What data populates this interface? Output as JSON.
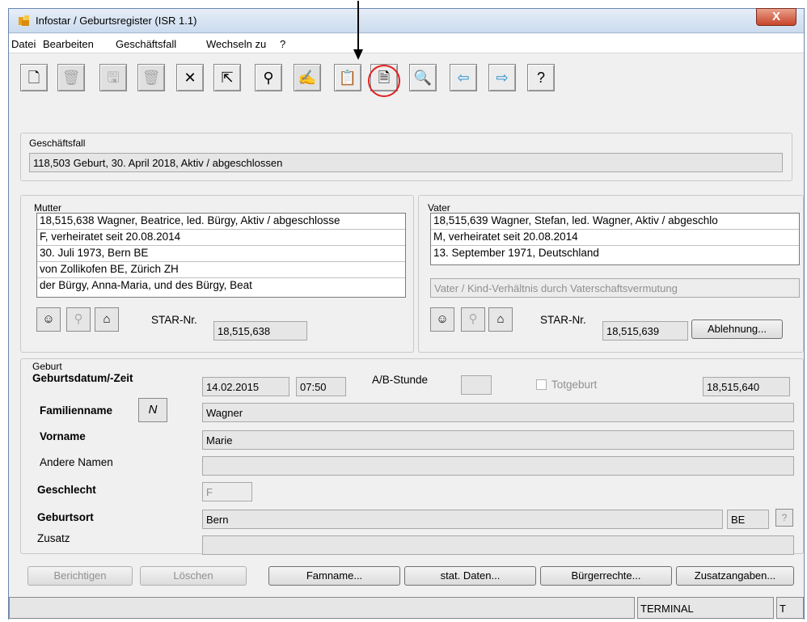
{
  "window": {
    "title": "Infostar / Geburtsregister (ISR 1.1)",
    "close": "X"
  },
  "menu": [
    "Datei",
    "Bearbeiten",
    "Geschäftsfall",
    "Wechseln zu",
    "?"
  ],
  "geschaeftsfall": {
    "label": "Geschäftsfall",
    "value": "118,503  Geburt, 30. April 2018, Aktiv / abgeschlossen"
  },
  "mutter": {
    "label": "Mutter",
    "lines": [
      "18,515,638  Wagner, Beatrice, led. Bürgy, Aktiv / abgeschlosse",
      "F, verheiratet seit 20.08.2014",
      "30. Juli 1973, Bern BE",
      "von Zollikofen BE, Zürich ZH",
      "der Bürgy, Anna-Maria, und des Bürgy, Beat"
    ],
    "star_label": "STAR-Nr.",
    "star_value": "18,515,638"
  },
  "vater": {
    "label": "Vater",
    "lines": [
      "18,515,639  Wagner, Stefan, led. Wagner, Aktiv / abgeschlo",
      "M, verheiratet seit 20.08.2014",
      "13. September 1971, Deutschland"
    ],
    "relation": "Vater / Kind-Verhältnis durch Vaterschaftsvermutung",
    "star_label": "STAR-Nr.",
    "star_value": "18,515,639",
    "ablehnung": "Ablehnung..."
  },
  "geburt": {
    "label": "Geburt",
    "datum_label": "Geburtsdatum/-Zeit",
    "datum": "14.02.2015",
    "zeit": "07:50",
    "ab_label": "A/B-Stunde",
    "totgeburt": "Totgeburt",
    "star": "18,515,640",
    "famname_label": "Familienname",
    "n_button": "N",
    "famname": "Wagner",
    "vorname_label": "Vorname",
    "vorname": "Marie",
    "andere_label": "Andere Namen",
    "geschlecht_label": "Geschlecht",
    "geschlecht": "F",
    "ort_label": "Geburtsort",
    "ort": "Bern",
    "kanton": "BE",
    "help": "?",
    "zusatz_label": "Zusatz"
  },
  "buttons": {
    "berichtigen": "Berichtigen",
    "loeschen": "Löschen",
    "famname": "Famname...",
    "stat": "stat. Daten...",
    "buerger": "Bürgerrechte...",
    "zusatz": "Zusatzangaben..."
  },
  "status": {
    "terminal": "TERMINAL",
    "t": "T"
  },
  "icons": [
    "new-document-icon",
    "trash-icon",
    "save-icon",
    "trash-icon",
    "delete-icon",
    "import-icon",
    "binoculars-icon",
    "sign-icon",
    "paste-icon",
    "document-icon",
    "preview-icon",
    "arrow-left-icon",
    "arrow-right-icon",
    "help-icon"
  ]
}
